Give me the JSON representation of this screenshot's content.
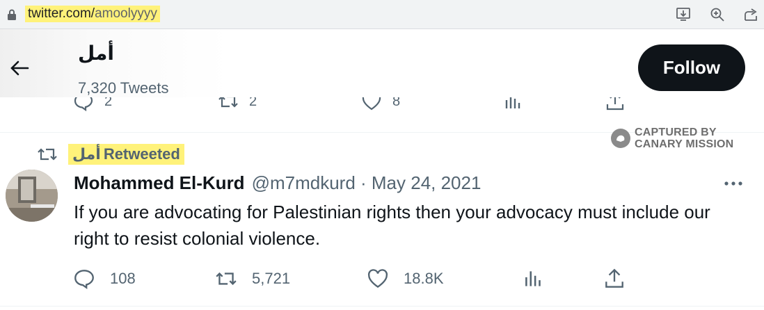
{
  "browser": {
    "url_domain": "twitter.com/",
    "url_path": "amoolyyyy",
    "icons": [
      "lock-icon",
      "install-app-icon",
      "zoom-icon",
      "share-icon"
    ]
  },
  "header": {
    "display_name": "أمل",
    "tweet_count": "7,320 Tweets",
    "follow_label": "Follow"
  },
  "previous_tweet": {
    "replies": "2",
    "retweets": "2",
    "likes": "8"
  },
  "watermark": {
    "line1": "CAPTURED BY",
    "line2": "CANARY MISSION"
  },
  "tweet": {
    "retweeted_by": "أمل",
    "retweeted_label": "Retweeted",
    "author_name": "Mohammed El-Kurd",
    "meta": "@m7mdkurd · May 24, 2021",
    "text": "If you are advocating for Palestinian rights then your advocacy must include our right to resist colonial violence.",
    "replies": "108",
    "retweets": "5,721",
    "likes": "18.8K"
  },
  "colors": {
    "highlight": "#fff27a",
    "text_primary": "#0f1419",
    "text_secondary": "#536471",
    "follow_bg": "#0f1419"
  }
}
